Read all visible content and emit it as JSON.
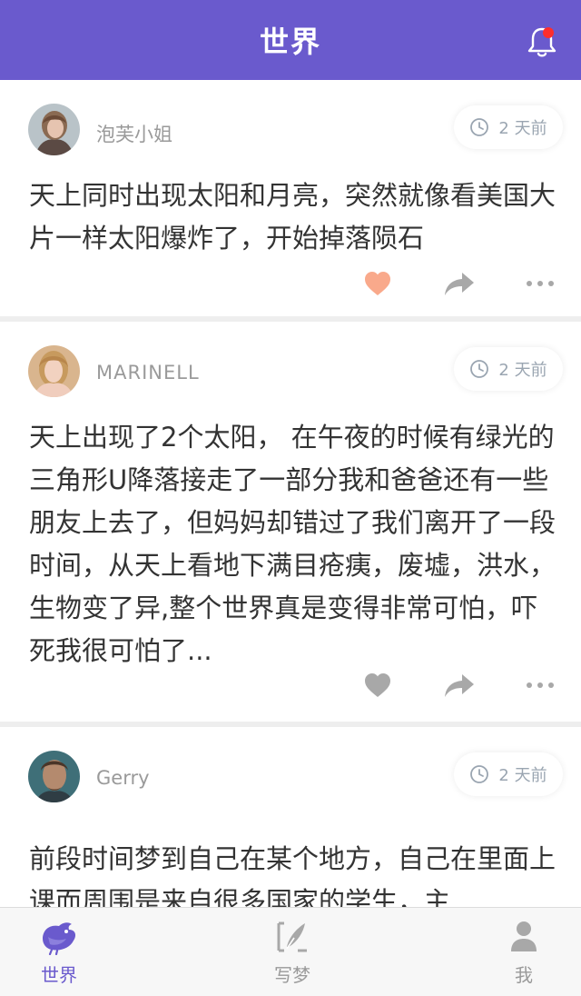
{
  "header": {
    "title": "世界",
    "has_notification": true
  },
  "colors": {
    "primary": "#6a5acd",
    "liked": "#f9a98b",
    "icon_gray": "#a8a8a8",
    "notification": "#ff2d2d"
  },
  "posts": [
    {
      "username": "泡芙小姐",
      "time": "2 天前",
      "content": "天上同时出现太阳和月亮，突然就像看美国大片一样太阳爆炸了，开始掉落陨石",
      "liked": true
    },
    {
      "username": "MARINELL",
      "time": "2 天前",
      "content": "天上出现了2个太阳， 在午夜的时候有绿光的三角形U降落接走了一部分我和爸爸还有一些朋友上去了，但妈妈却错过了我们离开了一段时间，从天上看地下满目疮痍，废墟，洪水，生物变了异,整个世界真是变得非常可怕，吓死我很可怕了...",
      "liked": false
    },
    {
      "username": "Gerry",
      "time": "2 天前",
      "content": "前段时间梦到自己在某个地方，自己在里面上课而周围是来自很多国家的学生，主",
      "liked": false
    }
  ],
  "tabbar": {
    "items": [
      {
        "label": "世界",
        "icon": "bird-icon",
        "active": true
      },
      {
        "label": "写梦",
        "icon": "quill-icon",
        "active": false
      },
      {
        "label": "我",
        "icon": "person-icon",
        "active": false
      }
    ]
  }
}
